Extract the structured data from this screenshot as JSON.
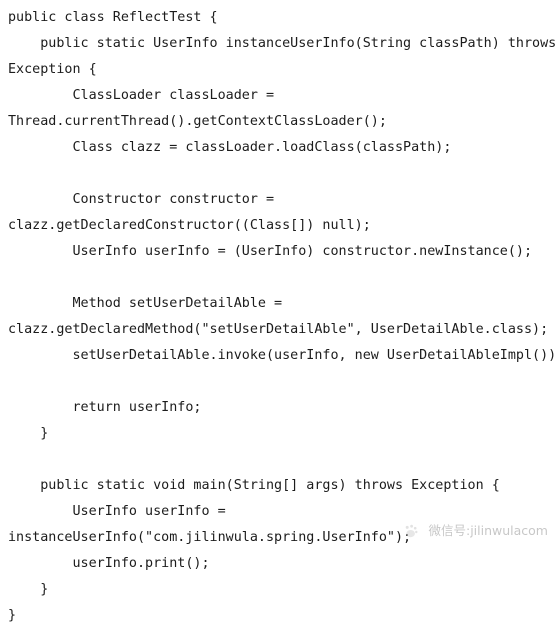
{
  "document": {
    "type": "code-snippet",
    "language": "java",
    "background_color": "#ffffff",
    "text_color": "#1c1c1c"
  },
  "code": {
    "lines": [
      "public class ReflectTest {",
      "    public static UserInfo instanceUserInfo(String classPath) throws",
      "Exception {",
      "        ClassLoader classLoader =",
      "Thread.currentThread().getContextClassLoader();",
      "        Class clazz = classLoader.loadClass(classPath);",
      "",
      "        Constructor constructor =",
      "clazz.getDeclaredConstructor((Class[]) null);",
      "        UserInfo userInfo = (UserInfo) constructor.newInstance();",
      "",
      "        Method setUserDetailAble =",
      "clazz.getDeclaredMethod(\"setUserDetailAble\", UserDetailAble.class);",
      "        setUserDetailAble.invoke(userInfo, new UserDetailAbleImpl());",
      "",
      "        return userInfo;",
      "    }",
      "",
      "    public static void main(String[] args) throws Exception {",
      "        UserInfo userInfo =",
      "instanceUserInfo(\"com.jilinwula.spring.UserInfo\");",
      "        userInfo.print();",
      "    }",
      "}"
    ]
  },
  "watermark": {
    "logo_icon": "wechat-paw-logo-icon",
    "text": "微信号:jilinwulacom",
    "color": "#9a9a9a"
  }
}
